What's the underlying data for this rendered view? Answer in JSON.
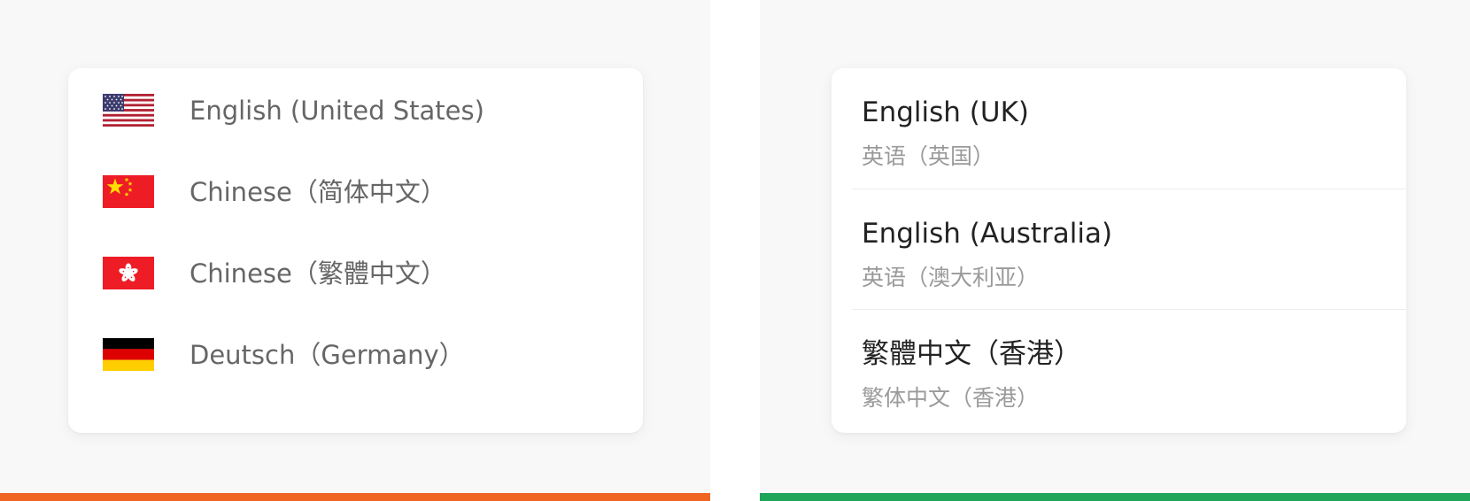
{
  "left_panel": {
    "accent_color": "#f06424",
    "languages": [
      {
        "flag": "us-flag-icon",
        "label": "English (United States)"
      },
      {
        "flag": "cn-flag-icon",
        "label": "Chinese（简体中文）"
      },
      {
        "flag": "hk-flag-icon",
        "label": "Chinese（繁體中文）"
      },
      {
        "flag": "de-flag-icon",
        "label": "Deutsch（Germany）"
      }
    ]
  },
  "right_panel": {
    "accent_color": "#1ea55a",
    "regions": [
      {
        "title": "English (UK)",
        "subtitle": "英语（英国）"
      },
      {
        "title": "English (Australia)",
        "subtitle": "英语（澳大利亚）"
      },
      {
        "title": "繁體中文（香港）",
        "subtitle": "繁体中文（香港）"
      }
    ]
  }
}
